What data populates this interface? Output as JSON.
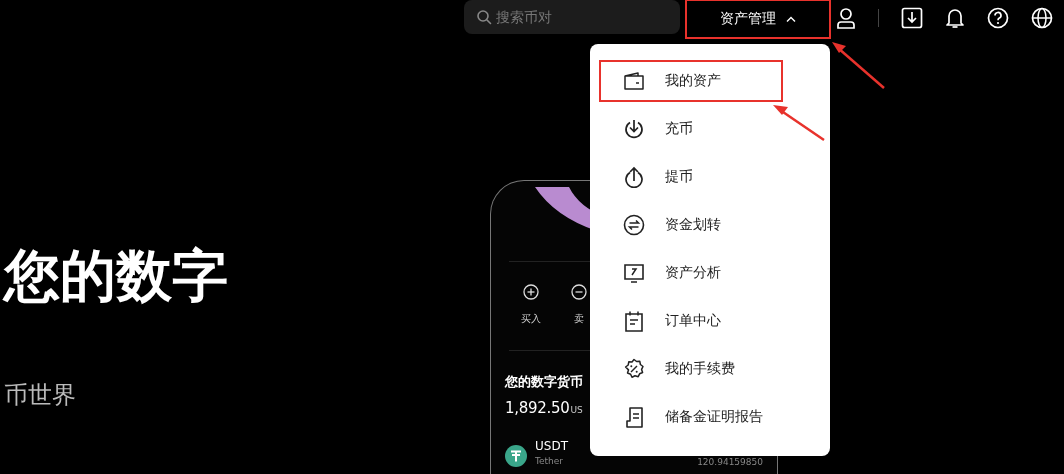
{
  "search": {
    "placeholder": "搜索币对"
  },
  "nav": {
    "label": "资产管理",
    "expanded": true,
    "annotated": true
  },
  "hero": {
    "title": "您的数字",
    "subtitle": "币世界"
  },
  "phone": {
    "actions": [
      {
        "label": "买入",
        "kind": "plus"
      },
      {
        "label": "卖",
        "kind": "minus"
      }
    ],
    "balance_title": "您的数字货币",
    "balance": "1,892.50",
    "currency": "US",
    "assets": [
      {
        "symbol": "USDT",
        "name": "Tether",
        "amount": "120.94159850"
      }
    ]
  },
  "menu": {
    "items": [
      {
        "label": "我的资产",
        "kind": "wallet",
        "annotated": true
      },
      {
        "label": "充币",
        "kind": "deposit",
        "annotated": false
      },
      {
        "label": "提币",
        "kind": "withdraw",
        "annotated": false
      },
      {
        "label": "资金划转",
        "kind": "transfer",
        "annotated": false
      },
      {
        "label": "资产分析",
        "kind": "analysis",
        "annotated": false
      },
      {
        "label": "订单中心",
        "kind": "orders",
        "annotated": false
      },
      {
        "label": "我的手续费",
        "kind": "fees",
        "annotated": false
      },
      {
        "label": "储备金证明报告",
        "kind": "reserve",
        "annotated": false
      }
    ]
  }
}
